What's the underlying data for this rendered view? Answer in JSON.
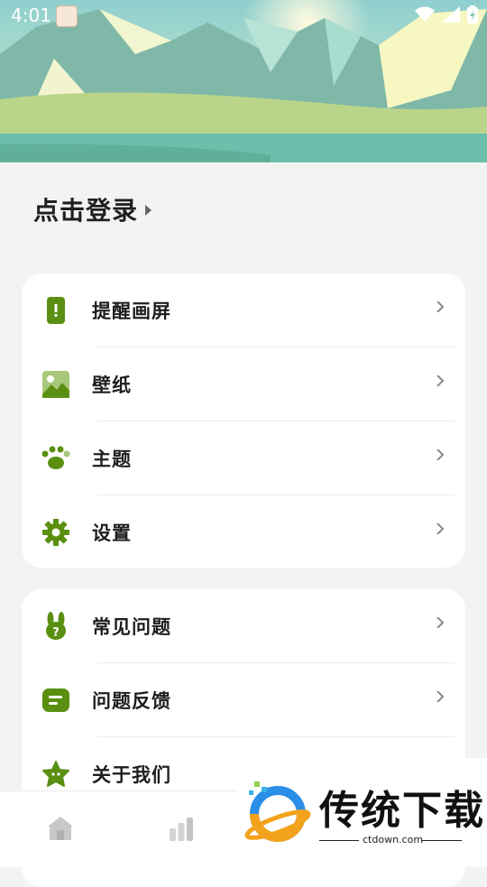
{
  "status_bar": {
    "time": "4:01"
  },
  "login": {
    "label": "点击登录"
  },
  "menu_group1": [
    {
      "label": "提醒画屏",
      "icon": "phone-alert-icon"
    },
    {
      "label": "壁纸",
      "icon": "image-icon"
    },
    {
      "label": "主题",
      "icon": "paw-icon"
    },
    {
      "label": "设置",
      "icon": "gear-icon"
    }
  ],
  "menu_group2": [
    {
      "label": "常见问题",
      "icon": "bunny-question-icon"
    },
    {
      "label": "问题反馈",
      "icon": "chat-icon"
    },
    {
      "label": "关于我们",
      "icon": "star-face-icon"
    }
  ],
  "watermark": {
    "brand": "传统下载",
    "url": "ctdown.com"
  },
  "colors": {
    "accent": "#5a8f12",
    "background": "#f3f3f3"
  }
}
